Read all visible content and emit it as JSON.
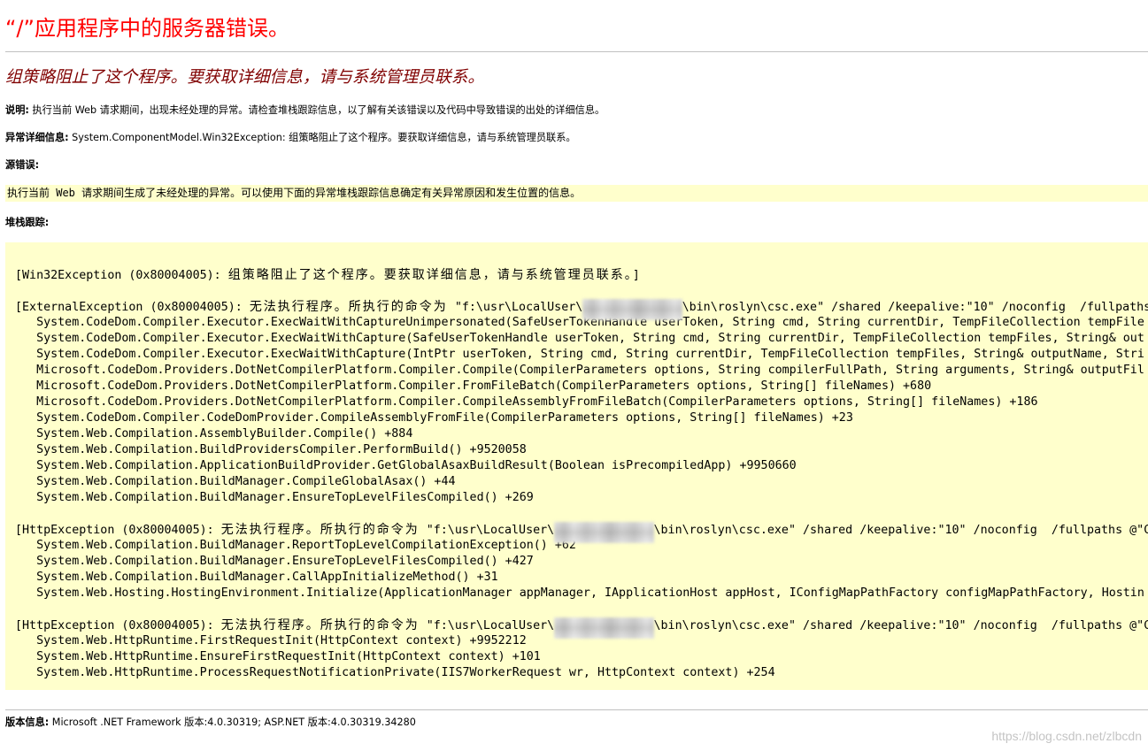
{
  "page_title": "“/”应用程序中的服务器错误。",
  "error_heading": "组策略阻止了这个程序。要获取详细信息，请与系统管理员联系。",
  "description": {
    "label": "说明:",
    "text": "执行当前 Web 请求期间，出现未经处理的异常。请检查堆栈跟踪信息，以了解有关该错误以及代码中导致错误的出处的详细信息。"
  },
  "exception_details": {
    "label": "异常详细信息:",
    "text": "System.ComponentModel.Win32Exception: 组策略阻止了这个程序。要获取详细信息，请与系统管理员联系。"
  },
  "source_error": {
    "label": "源错误:",
    "text": "执行当前 Web 请求期间生成了未经处理的异常。可以使用下面的异常堆栈跟踪信息确定有关异常原因和发生位置的信息。"
  },
  "stack_trace": {
    "label": "堆栈跟踪:",
    "lines": [
      "",
      "[Win32Exception (0x80004005): 组策略阻止了这个程序。要获取详细信息，请与系统管理员联系。]",
      "",
      {
        "before": "[ExternalException (0x80004005): 无法执行程序。所执行的命令为 \"f:\\usr\\LocalUser\\",
        "after": "\\bin\\roslyn\\csc.exe\" /shared /keepalive:\"10\" /noconfig  /fullpaths"
      },
      "   System.CodeDom.Compiler.Executor.ExecWaitWithCaptureUnimpersonated(SafeUserTokenHandle userToken, String cmd, String currentDir, TempFileCollection tempFile",
      "   System.CodeDom.Compiler.Executor.ExecWaitWithCapture(SafeUserTokenHandle userToken, String cmd, String currentDir, TempFileCollection tempFiles, String& out",
      "   System.CodeDom.Compiler.Executor.ExecWaitWithCapture(IntPtr userToken, String cmd, String currentDir, TempFileCollection tempFiles, String& outputName, Stri",
      "   Microsoft.CodeDom.Providers.DotNetCompilerPlatform.Compiler.Compile(CompilerParameters options, String compilerFullPath, String arguments, String& outputFil",
      "   Microsoft.CodeDom.Providers.DotNetCompilerPlatform.Compiler.FromFileBatch(CompilerParameters options, String[] fileNames) +680",
      "   Microsoft.CodeDom.Providers.DotNetCompilerPlatform.Compiler.CompileAssemblyFromFileBatch(CompilerParameters options, String[] fileNames) +186",
      "   System.CodeDom.Compiler.CodeDomProvider.CompileAssemblyFromFile(CompilerParameters options, String[] fileNames) +23",
      "   System.Web.Compilation.AssemblyBuilder.Compile() +884",
      "   System.Web.Compilation.BuildProvidersCompiler.PerformBuild() +9520058",
      "   System.Web.Compilation.ApplicationBuildProvider.GetGlobalAsaxBuildResult(Boolean isPrecompiledApp) +9950660",
      "   System.Web.Compilation.BuildManager.CompileGlobalAsax() +44",
      "   System.Web.Compilation.BuildManager.EnsureTopLevelFilesCompiled() +269",
      "",
      {
        "before": "[HttpException (0x80004005): 无法执行程序。所执行的命令为 \"f:\\usr\\LocalUser\\",
        "after": "\\bin\\roslyn\\csc.exe\" /shared /keepalive:\"10\" /noconfig  /fullpaths @\"C"
      },
      "   System.Web.Compilation.BuildManager.ReportTopLevelCompilationException() +62",
      "   System.Web.Compilation.BuildManager.EnsureTopLevelFilesCompiled() +427",
      "   System.Web.Compilation.BuildManager.CallAppInitializeMethod() +31",
      "   System.Web.Hosting.HostingEnvironment.Initialize(ApplicationManager appManager, IApplicationHost appHost, IConfigMapPathFactory configMapPathFactory, Hostin",
      "",
      {
        "before": "[HttpException (0x80004005): 无法执行程序。所执行的命令为 \"f:\\usr\\LocalUser\\",
        "after": "\\bin\\roslyn\\csc.exe\" /shared /keepalive:\"10\" /noconfig  /fullpaths @\"C"
      },
      "   System.Web.HttpRuntime.FirstRequestInit(HttpContext context) +9952212",
      "   System.Web.HttpRuntime.EnsureFirstRequestInit(HttpContext context) +101",
      "   System.Web.HttpRuntime.ProcessRequestNotificationPrivate(IIS7WorkerRequest wr, HttpContext context) +254"
    ]
  },
  "version_info": {
    "label": "版本信息:",
    "text": "Microsoft .NET Framework 版本:4.0.30319; ASP.NET 版本:4.0.30319.34280"
  },
  "watermark": "https://blog.csdn.net/zlbcdn",
  "colors": {
    "title": "#ff0000",
    "heading": "#800000",
    "code_background": "#ffffcc",
    "rule": "#c0c0c0",
    "watermark": "#c4c4c4"
  }
}
